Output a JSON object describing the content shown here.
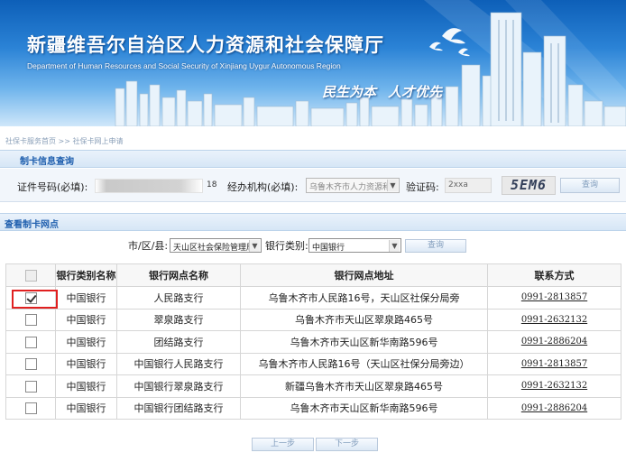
{
  "header": {
    "title": "新疆维吾尔自治区人力资源和社会保障厅",
    "subtitle": "Department of Human Resources and Social Security of Xinjiang Uygur Autonomous Region",
    "slogan_1": "民生为本",
    "slogan_2": "人才优先"
  },
  "breadcrumb": "社保卡服务首页 >> 社保卡网上申请",
  "query": {
    "section_title": "制卡信息查询",
    "id_label": "证件号码(必填):",
    "id_suffix": "18",
    "agency_label": "经办机构(必填):",
    "agency_value": "乌鲁木齐市人力资源和",
    "verify_label": "验证码:",
    "verify_value": "2xxa",
    "captcha_text": "5EM6",
    "query_button": "查询"
  },
  "outlets": {
    "section_title": "查看制卡网点",
    "city_label": "市/区/县:",
    "city_value": "天山区社会保险管理局",
    "bank_label": "银行类别:",
    "bank_value": "中国银行",
    "query_button": "查询",
    "columns": [
      "银行类别名称",
      "银行网点名称",
      "银行网点地址",
      "联系方式"
    ],
    "rows": [
      {
        "checked": true,
        "bank": "中国银行",
        "branch": "人民路支行",
        "address": "乌鲁木齐市人民路16号，天山区社保分局旁",
        "phone": "0991-2813857"
      },
      {
        "checked": false,
        "bank": "中国银行",
        "branch": "翠泉路支行",
        "address": "乌鲁木齐市天山区翠泉路465号",
        "phone": "0991-2632132"
      },
      {
        "checked": false,
        "bank": "中国银行",
        "branch": "团结路支行",
        "address": "乌鲁木齐市天山区新华南路596号",
        "phone": "0991-2886204"
      },
      {
        "checked": false,
        "bank": "中国银行",
        "branch": "中国银行人民路支行",
        "address": "乌鲁木齐市人民路16号（天山区社保分局旁边）",
        "phone": "0991-2813857"
      },
      {
        "checked": false,
        "bank": "中国银行",
        "branch": "中国银行翠泉路支行",
        "address": "新疆乌鲁木齐市天山区翠泉路465号",
        "phone": "0991-2632132"
      },
      {
        "checked": false,
        "bank": "中国银行",
        "branch": "中国银行团结路支行",
        "address": "乌鲁木齐市天山区新华南路596号",
        "phone": "0991-2886204"
      }
    ]
  },
  "pager": {
    "prev": "上一步",
    "next": "下一步"
  },
  "colors": {
    "banner_top": "#0d5fb8",
    "section_title": "#1f5fae",
    "highlight": "#e02020"
  }
}
